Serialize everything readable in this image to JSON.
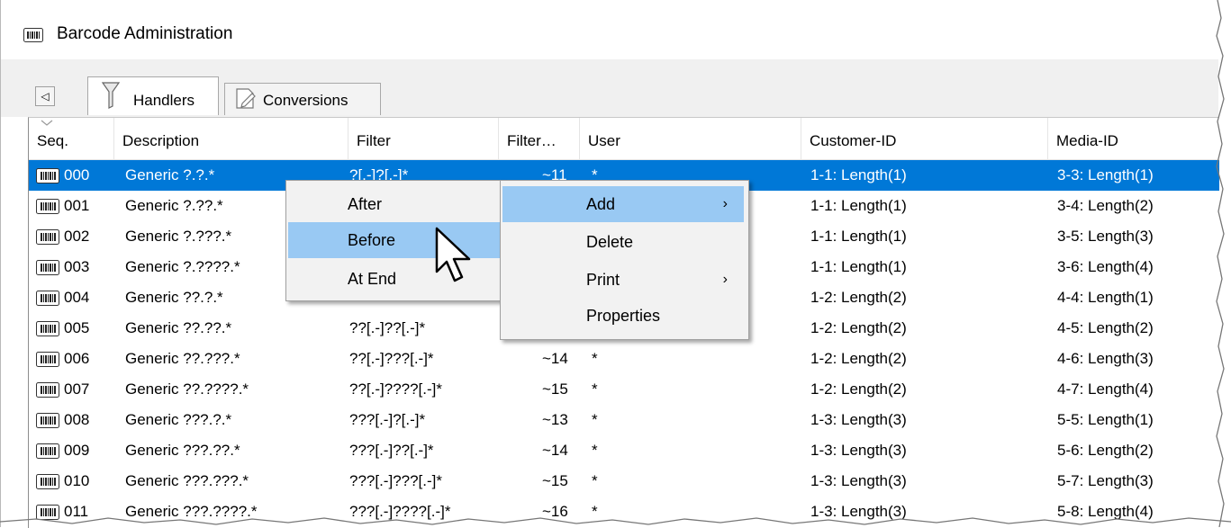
{
  "window": {
    "title": "Barcode Administration",
    "icon": "barcode-icon"
  },
  "tabs": [
    {
      "label": "Handlers",
      "icon": "funnel-icon",
      "active": true
    },
    {
      "label": "Conversions",
      "icon": "edit-page-icon",
      "active": false
    }
  ],
  "columns": [
    "Seq.",
    "Description",
    "Filter",
    "Filter…",
    "User",
    "Customer-ID",
    "Media-ID"
  ],
  "rows": [
    {
      "seq": "000",
      "description": "Generic ?.?.*",
      "filter": "?[.-]?[.-]*",
      "flen": "~11",
      "user": "*",
      "customer": "1-1: Length(1)",
      "media": "3-3: Length(1)"
    },
    {
      "seq": "001",
      "description": "Generic ?.??.*",
      "filter": "",
      "flen": "",
      "user": "",
      "customer": "1-1: Length(1)",
      "media": "3-4: Length(2)"
    },
    {
      "seq": "002",
      "description": "Generic ?.???.*",
      "filter": "",
      "flen": "",
      "user": "",
      "customer": "1-1: Length(1)",
      "media": "3-5: Length(3)"
    },
    {
      "seq": "003",
      "description": "Generic ?.????.*",
      "filter": "",
      "flen": "",
      "user": "",
      "customer": "1-1: Length(1)",
      "media": "3-6: Length(4)"
    },
    {
      "seq": "004",
      "description": "Generic ??.?.*",
      "filter": "",
      "flen": "",
      "user": "",
      "customer": "1-2: Length(2)",
      "media": "4-4: Length(1)"
    },
    {
      "seq": "005",
      "description": "Generic ??.??.*",
      "filter": "??[.-]??[.-]*",
      "flen": "",
      "user": "",
      "customer": "1-2: Length(2)",
      "media": "4-5: Length(2)"
    },
    {
      "seq": "006",
      "description": "Generic ??.???.*",
      "filter": "??[.-]???[.-]*",
      "flen": "~14",
      "user": "*",
      "customer": "1-2: Length(2)",
      "media": "4-6: Length(3)"
    },
    {
      "seq": "007",
      "description": "Generic ??.????.*",
      "filter": "??[.-]????[.-]*",
      "flen": "~15",
      "user": "*",
      "customer": "1-2: Length(2)",
      "media": "4-7: Length(4)"
    },
    {
      "seq": "008",
      "description": "Generic ???.?.*",
      "filter": "???[.-]?[.-]*",
      "flen": "~13",
      "user": "*",
      "customer": "1-3: Length(3)",
      "media": "5-5: Length(1)"
    },
    {
      "seq": "009",
      "description": "Generic ???.??.*",
      "filter": "???[.-]??[.-]*",
      "flen": "~14",
      "user": "*",
      "customer": "1-3: Length(3)",
      "media": "5-6: Length(2)"
    },
    {
      "seq": "010",
      "description": "Generic ???.???.*",
      "filter": "???[.-]???[.-]*",
      "flen": "~15",
      "user": "*",
      "customer": "1-3: Length(3)",
      "media": "5-7: Length(3)"
    },
    {
      "seq": "011",
      "description": "Generic ???.????.*",
      "filter": "???[.-]????[.-]*",
      "flen": "~16",
      "user": "*",
      "customer": "1-3: Length(3)",
      "media": "5-8: Length(4)"
    }
  ],
  "context_menu": {
    "items": [
      {
        "label": "Add",
        "submenu": true,
        "highlighted": true
      },
      {
        "label": "Delete",
        "submenu": false
      },
      {
        "label": "Print",
        "submenu": true
      },
      {
        "label": "Properties",
        "submenu": false
      }
    ],
    "submenu_arrow": "›"
  },
  "submenu": {
    "items": [
      {
        "label": "After"
      },
      {
        "label": "Before",
        "highlighted": true
      },
      {
        "label": "At End"
      }
    ]
  },
  "scroll_left_glyph": "◁",
  "colors": {
    "selection": "#0078d7",
    "menu_highlight": "#99c9f3",
    "menu_bg": "#f2f2f2"
  }
}
